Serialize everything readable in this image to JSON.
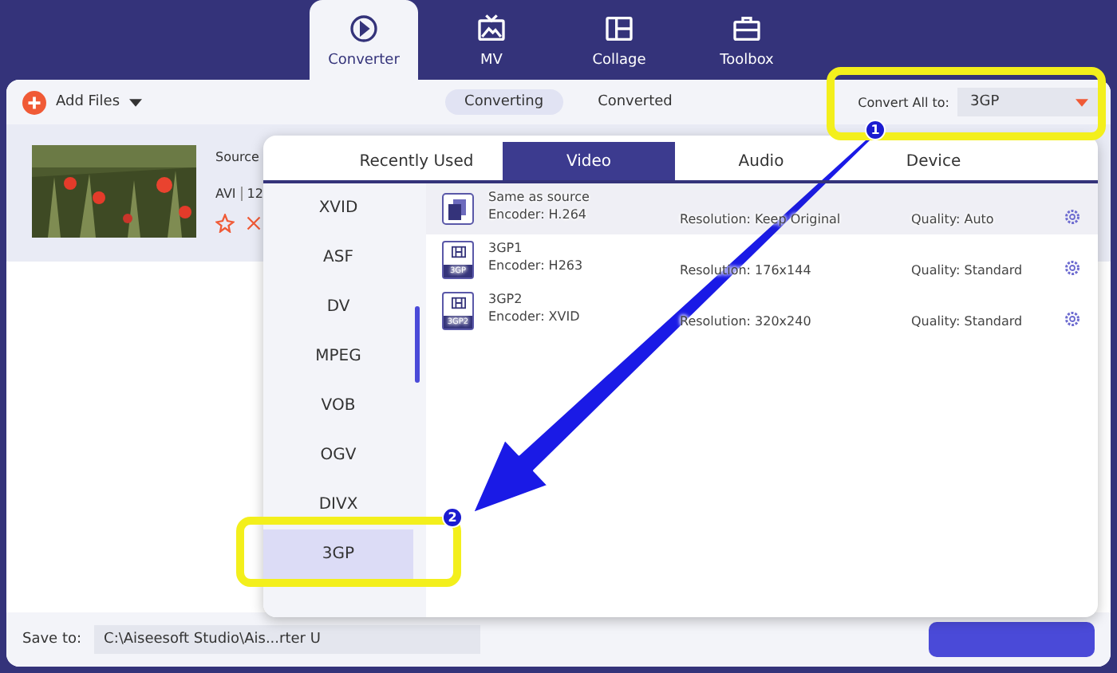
{
  "nav_tabs": [
    {
      "label": "Converter",
      "selected": true
    },
    {
      "label": "MV",
      "selected": false
    },
    {
      "label": "Collage",
      "selected": false
    },
    {
      "label": "Toolbox",
      "selected": false
    }
  ],
  "toolbar": {
    "add_files": "Add Files",
    "view_tabs": [
      {
        "label": "Converting",
        "selected": true
      },
      {
        "label": "Converted",
        "selected": false
      }
    ],
    "convert_all_label": "Convert All to:",
    "convert_all_value": "3GP"
  },
  "file": {
    "source_label": "Source",
    "format": "AVI",
    "size": "12"
  },
  "format_popup": {
    "tabs": [
      {
        "label": "Recently Used",
        "selected": false
      },
      {
        "label": "Video",
        "selected": true
      },
      {
        "label": "Audio",
        "selected": false
      },
      {
        "label": "Device",
        "selected": false
      }
    ],
    "formats": [
      {
        "label": "XVID",
        "selected": false
      },
      {
        "label": "ASF",
        "selected": false
      },
      {
        "label": "DV",
        "selected": false
      },
      {
        "label": "MPEG",
        "selected": false
      },
      {
        "label": "VOB",
        "selected": false
      },
      {
        "label": "OGV",
        "selected": false
      },
      {
        "label": "DIVX",
        "selected": false
      },
      {
        "label": "3GP",
        "selected": true
      }
    ],
    "presets": [
      {
        "kind": "source",
        "name": "Same as source",
        "encoder": "Encoder: H.264",
        "resolution": "Resolution: Keep Original",
        "quality": "Quality: Auto",
        "selected": true
      },
      {
        "kind": "film",
        "badge": "3GP",
        "name": "3GP1",
        "encoder": "Encoder: H263",
        "resolution": "Resolution: 176x144",
        "quality": "Quality: Standard",
        "selected": false
      },
      {
        "kind": "film",
        "badge": "3GP2",
        "name": "3GP2",
        "encoder": "Encoder: XVID",
        "resolution": "Resolution: 320x240",
        "quality": "Quality: Standard",
        "selected": false
      }
    ]
  },
  "bottom_bar": {
    "save_label": "Save to:",
    "save_path": "C:\\Aiseesoft Studio\\Ais...rter U"
  },
  "annotations": [
    {
      "number": "1"
    },
    {
      "number": "2"
    }
  ]
}
